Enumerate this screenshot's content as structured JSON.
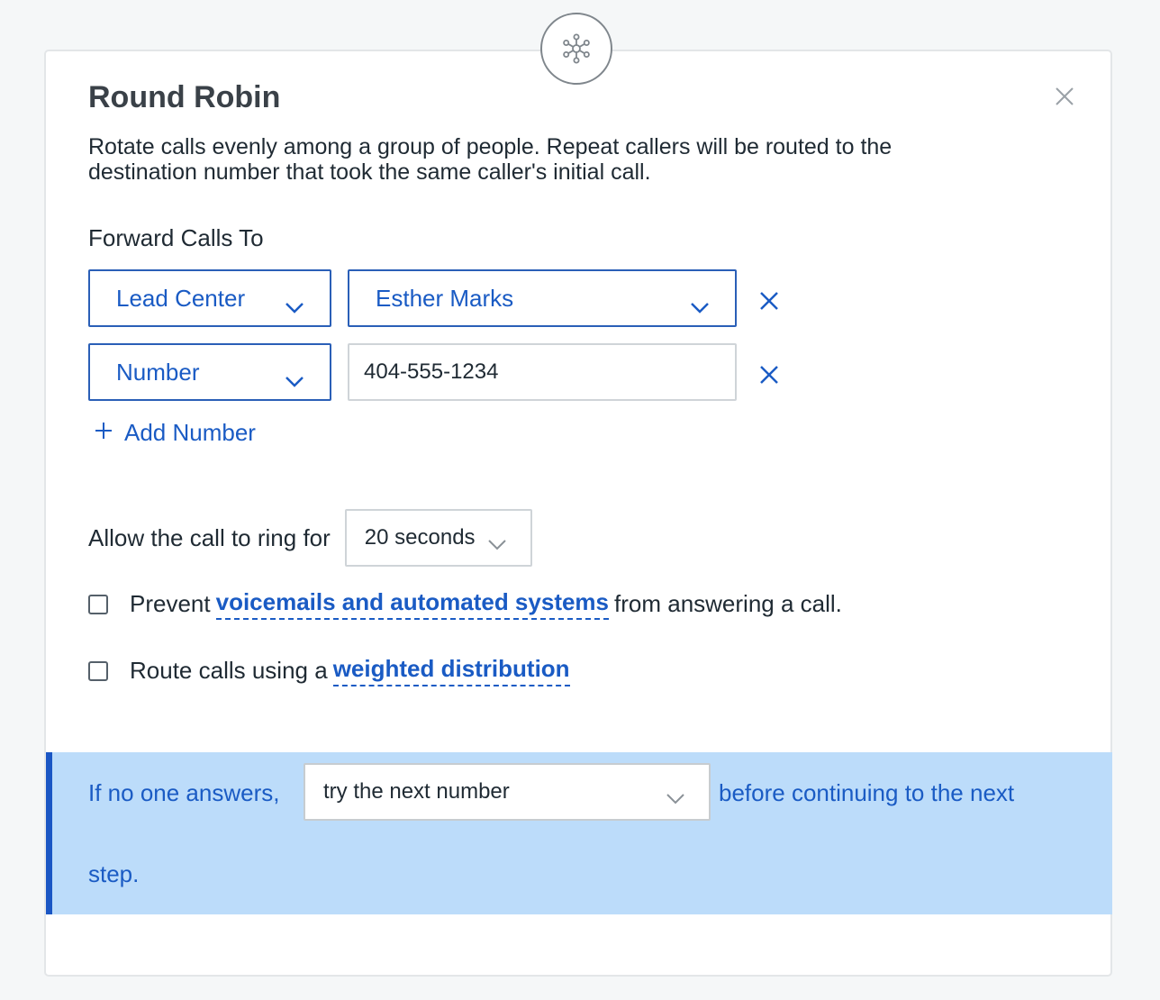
{
  "modal": {
    "title": "Round Robin",
    "description": "Rotate calls evenly among a group of people. Repeat callers will be routed to the destination number that took the same caller's initial call.",
    "node_icon": "network-node-icon",
    "close_icon": "close-icon"
  },
  "forward": {
    "label": "Forward Calls To",
    "rows": [
      {
        "type": "Lead Center",
        "target": "Esther Marks"
      },
      {
        "type": "Number",
        "number_value": "404-555-1234"
      }
    ],
    "add_label": "Add Number"
  },
  "ring": {
    "label": "Allow the call to ring for",
    "value": "20 seconds"
  },
  "options": {
    "prevent_prefix": "Prevent",
    "prevent_link": "voicemails and automated systems",
    "prevent_suffix": "from answering a call.",
    "route_prefix": "Route calls using a",
    "route_link": "weighted distribution"
  },
  "fallback": {
    "prefix": "If no one answers,",
    "value": "try the next number",
    "suffix": "before continuing to the next",
    "suffix_line2": "step."
  },
  "colors": {
    "accent": "#1a5bc4",
    "band": "#bcdcfa",
    "band_border": "#1a56c4"
  }
}
